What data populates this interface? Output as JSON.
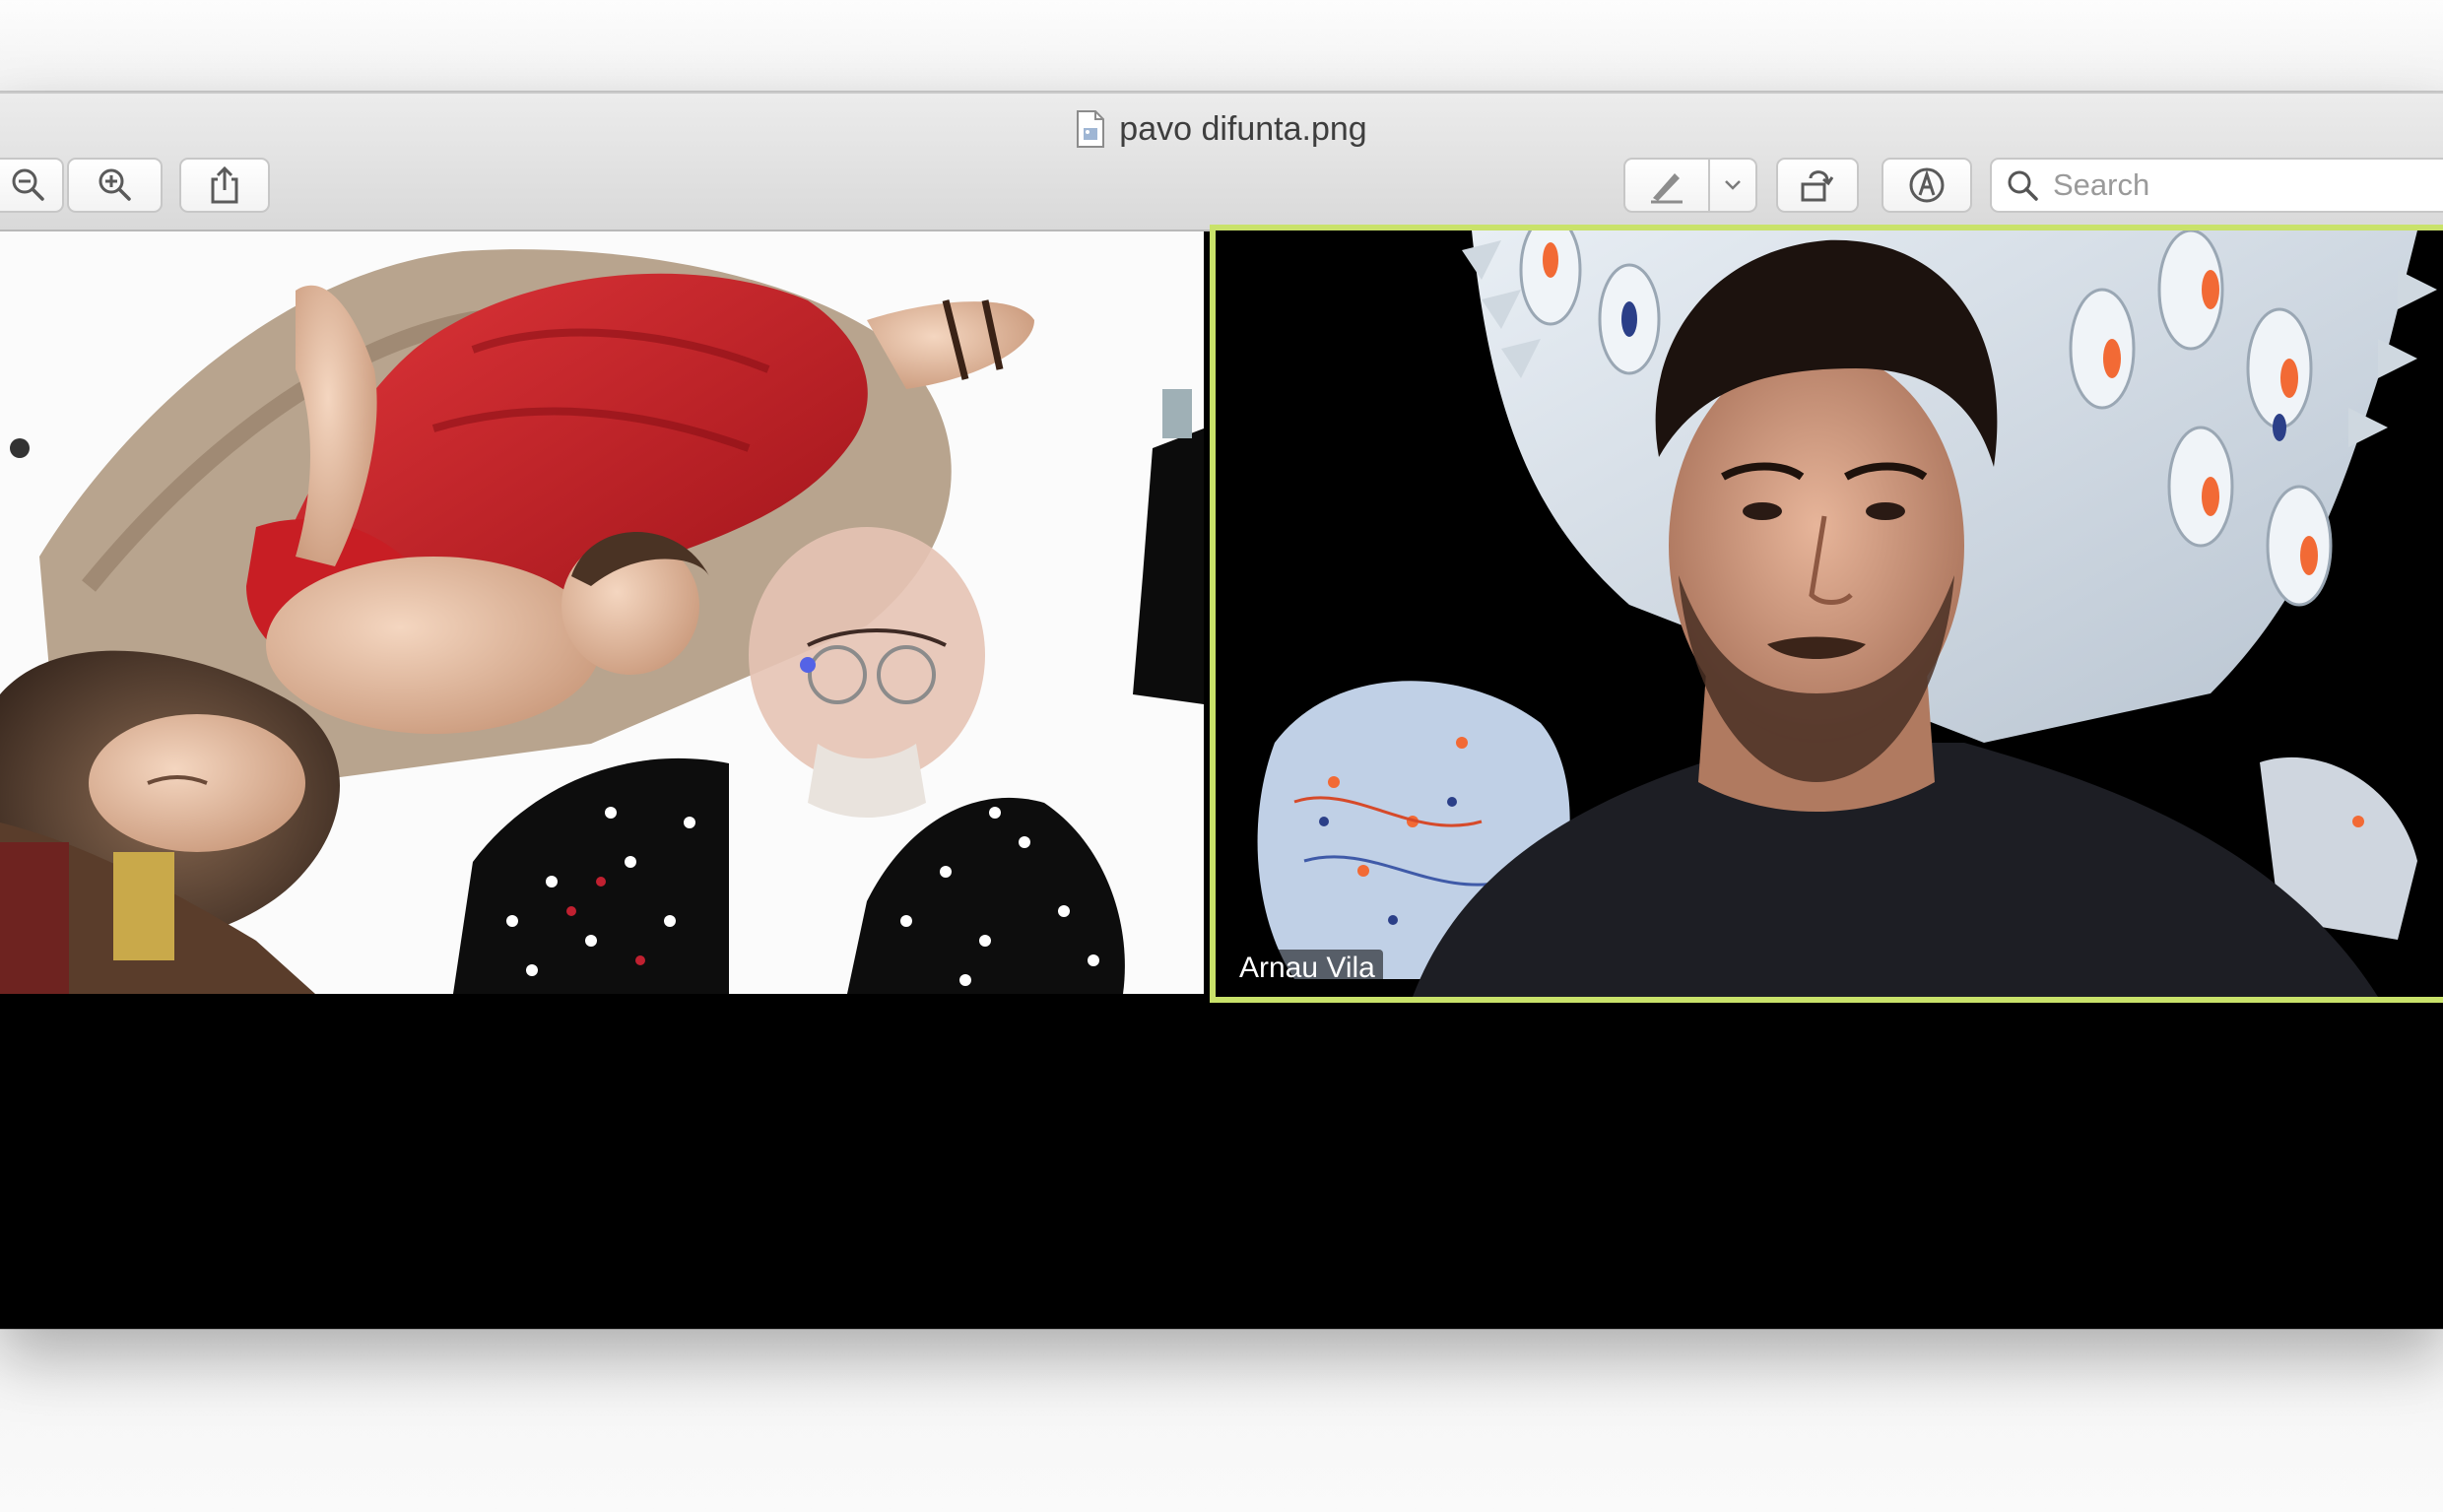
{
  "window": {
    "title": "pavo difunta.png"
  },
  "toolbar": {
    "zoom_out_icon": "zoom-out-icon",
    "zoom_in_icon": "zoom-in-icon",
    "share_icon": "share-icon",
    "markup_icon": "pen-markup-icon",
    "rotate_icon": "rotate-icon",
    "annotate_icon": "markup-circle-icon",
    "search_placeholder": "Search"
  },
  "video": {
    "right_participant_name": "Arnau Vila",
    "active_speaker_border": "#c9e26a"
  },
  "colors": {
    "toolbar_bg": "#e4e4e4",
    "stage_bg": "#000000",
    "robe_red": "#c8202a"
  }
}
